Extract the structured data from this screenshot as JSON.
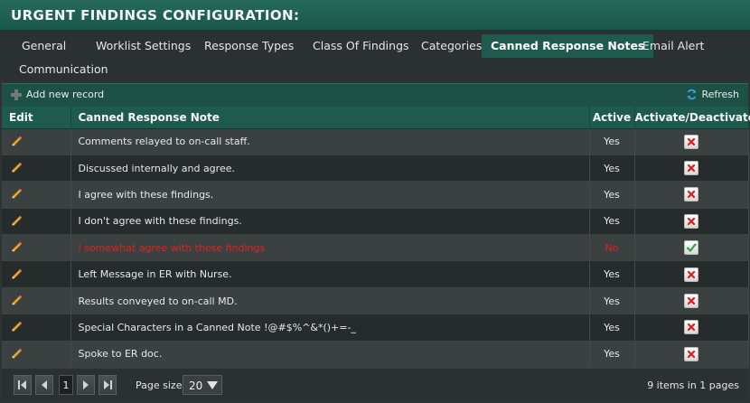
{
  "page_title": "URGENT FINDINGS CONFIGURATION:",
  "tabs": [
    {
      "label": "General"
    },
    {
      "label": "Worklist Settings"
    },
    {
      "label": "Response Types"
    },
    {
      "label": "Class Of Findings"
    },
    {
      "label": "Categories"
    },
    {
      "label": "Canned Response Notes",
      "active": true
    },
    {
      "label": "Email Alert"
    },
    {
      "label": "Communication"
    }
  ],
  "toolbar": {
    "add_label": "Add new record",
    "refresh_label": "Refresh"
  },
  "table": {
    "headers": {
      "edit": "Edit",
      "note": "Canned Response Note",
      "active": "Active",
      "toggle": "Activate/Deactivate"
    },
    "rows": [
      {
        "note": "Comments relayed to on-call staff.",
        "active": "Yes",
        "action": "deactivate"
      },
      {
        "note": "Discussed internally and agree.",
        "active": "Yes",
        "action": "deactivate"
      },
      {
        "note": "I agree with these findings.",
        "active": "Yes",
        "action": "deactivate"
      },
      {
        "note": "I don't agree with these findings.",
        "active": "Yes",
        "action": "deactivate"
      },
      {
        "note": "I somewhat agree with these findings",
        "active": "No",
        "action": "activate"
      },
      {
        "note": "Left Message in ER with Nurse.",
        "active": "Yes",
        "action": "deactivate"
      },
      {
        "note": "Results conveyed to on-call MD.",
        "active": "Yes",
        "action": "deactivate"
      },
      {
        "note": "Special Characters in a Canned Note !@#$%^&*()+=-_",
        "active": "Yes",
        "action": "deactivate"
      },
      {
        "note": "Spoke to ER doc.",
        "active": "Yes",
        "action": "deactivate"
      }
    ]
  },
  "pager": {
    "current_page": "1",
    "page_size_label": "Page size:",
    "page_size": "20",
    "summary": "9 items in 1 pages"
  },
  "colors": {
    "header_teal": "#1f5a4e",
    "inactive_red": "#e02020",
    "deactivate_x": "#d42020",
    "activate_check": "#2fa43a"
  },
  "icons": {
    "edit": "pencil-icon",
    "deactivate": "x-icon",
    "activate": "checkmark-icon",
    "add": "plus-icon",
    "refresh": "refresh-icon"
  }
}
